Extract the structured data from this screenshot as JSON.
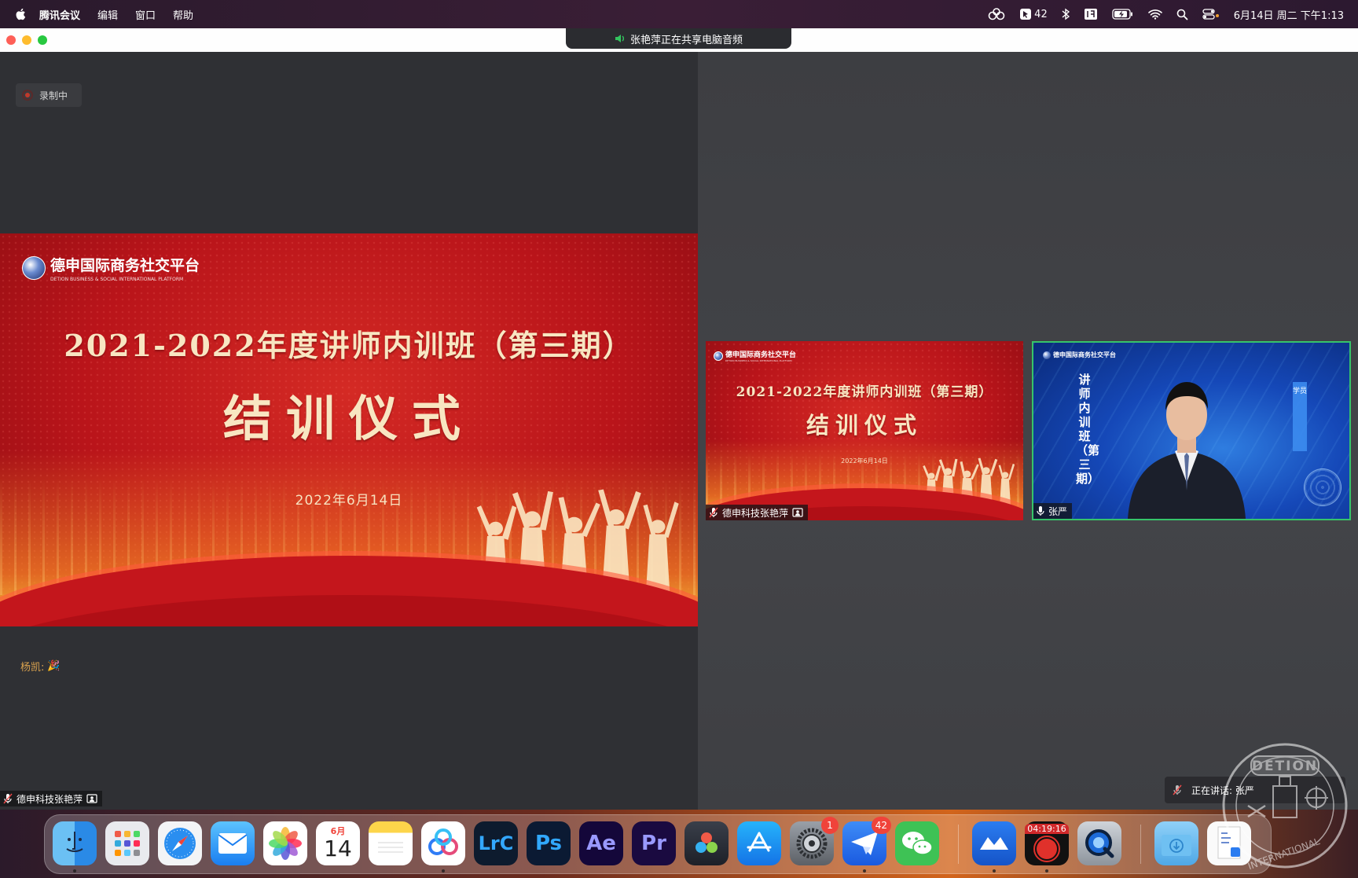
{
  "menubar": {
    "app_name": "腾讯会议",
    "menus": [
      "编辑",
      "窗口",
      "帮助"
    ],
    "status_count": "42",
    "datetime": "6月14日 周二 下午1:13"
  },
  "share_banner": "张艳萍正在共享电脑音频",
  "recording": "录制中",
  "slide": {
    "logo_cn": "德申国际商务社交平台",
    "logo_en": "DETION BUSINESS & SOCIAL INTERNATIONAL PLATFORM",
    "title": "2021-2022年度讲师内训班（第三期）",
    "subtitle": "结训仪式",
    "date": "2022年6月14日"
  },
  "video": {
    "logo_cn": "德申国际商务社交平台",
    "vertical_title": "讲师内训班（第三期）",
    "side_tag": "学员"
  },
  "tiles": {
    "presenter_name": "德申科技张艳萍",
    "speaker_name": "张严"
  },
  "bottom_left_name": "德申科技张艳萍",
  "chat": {
    "sender": "杨凯:",
    "emoji": "🎉"
  },
  "speaking": "正在讲话: 张严",
  "seal": {
    "top": "DETION",
    "bottom": "INTERNATIONAL"
  },
  "dock": {
    "calendar_month": "6月",
    "calendar_day": "14",
    "settings_badge": "1",
    "feishu_badge": "42",
    "recorder_time": "04:19:16",
    "lrc": "LrC",
    "ps": "Ps",
    "ae": "Ae",
    "pr": "Pr"
  },
  "colors": {
    "active_speaker_border": "#36c46a",
    "chat_name": "#d8a14e",
    "badge": "#f0433a"
  }
}
